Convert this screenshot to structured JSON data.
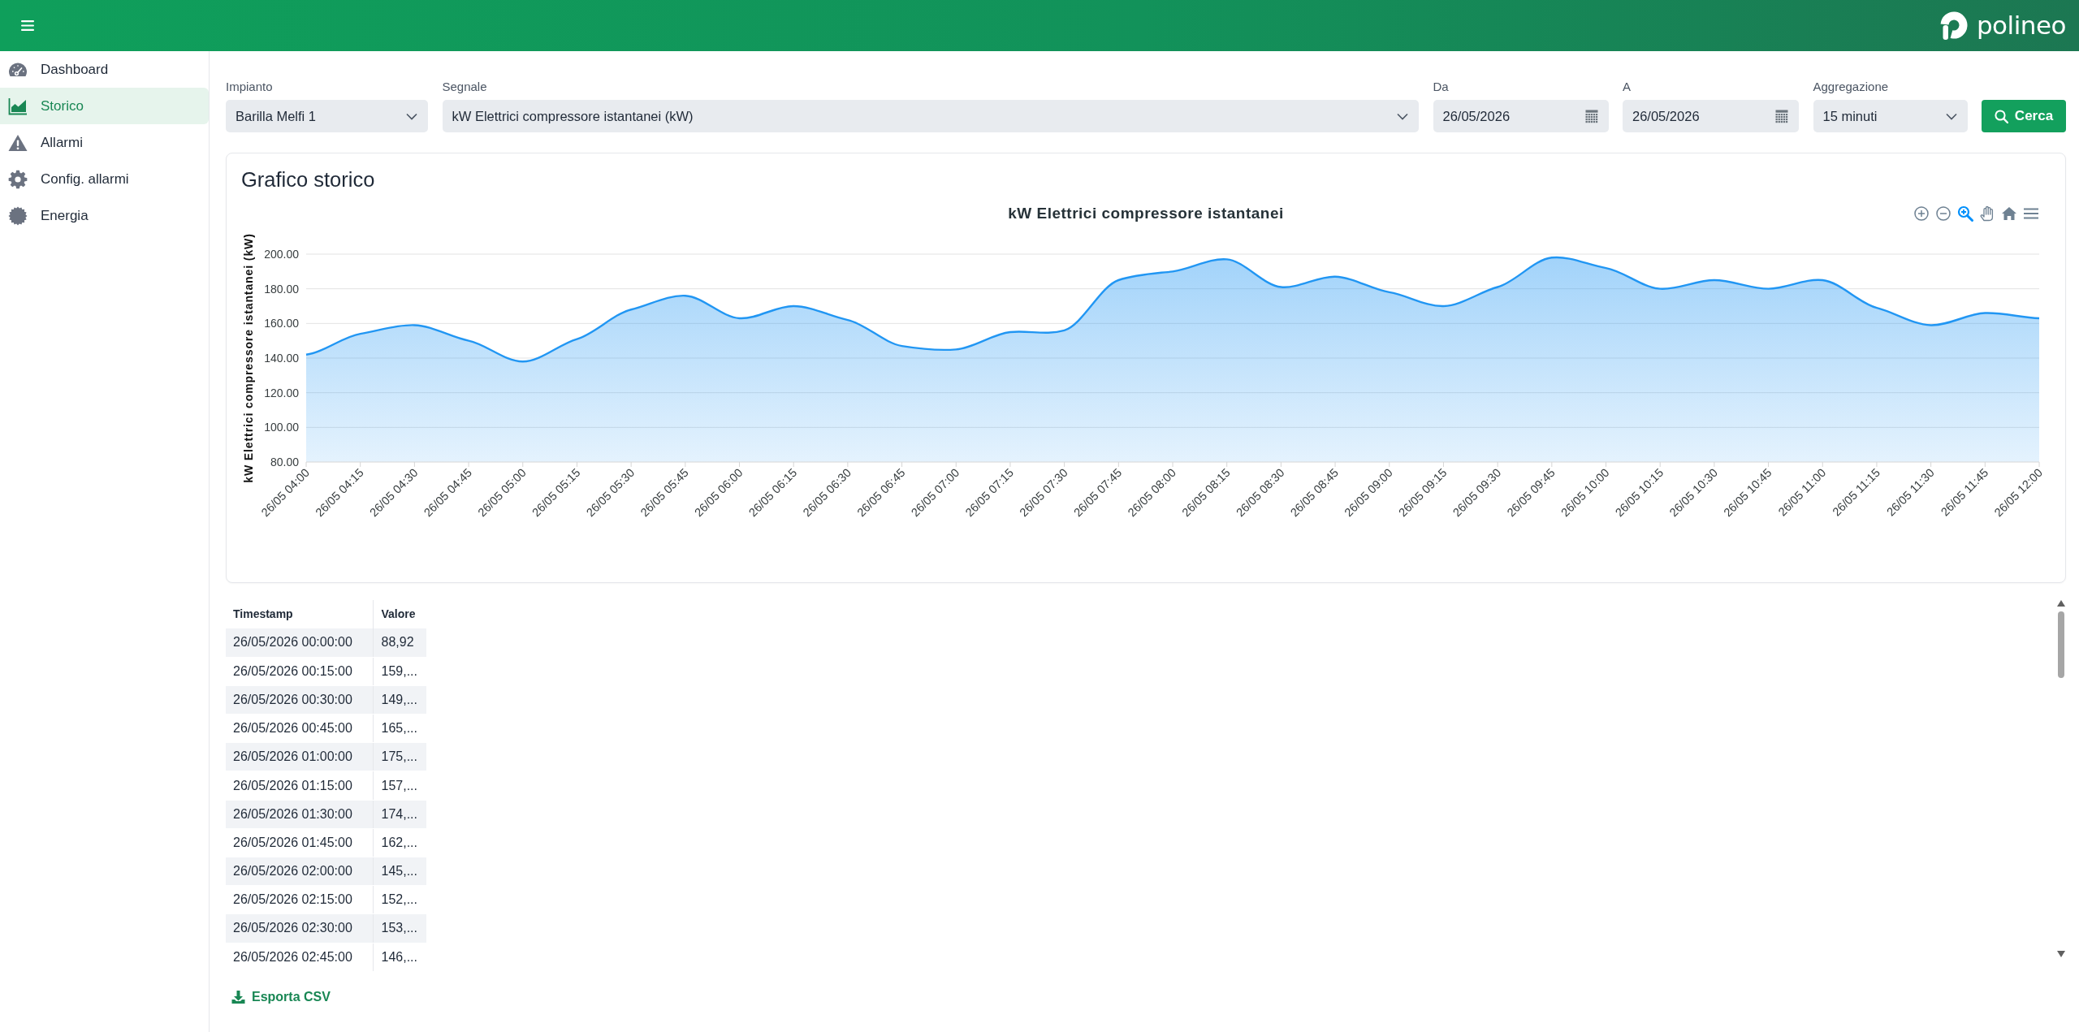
{
  "header": {
    "brand": "polineo"
  },
  "sidebar": {
    "items": [
      {
        "label": "Dashboard",
        "selected": false
      },
      {
        "label": "Storico",
        "selected": true
      },
      {
        "label": "Allarmi",
        "selected": false
      },
      {
        "label": "Config. allarmi",
        "selected": false
      },
      {
        "label": "Energia",
        "selected": false
      }
    ]
  },
  "filters": {
    "fields": [
      {
        "kind": "select",
        "label": "Impianto",
        "value": "Barilla Melfi 1"
      },
      {
        "kind": "select",
        "label": "Segnale",
        "value": "kW Elettrici compressore istantanei (kW)"
      },
      {
        "kind": "date",
        "label": "Da",
        "value": "26/05/2026"
      },
      {
        "kind": "date",
        "label": "A",
        "value": "26/05/2026"
      },
      {
        "kind": "select",
        "label": "Aggregazione",
        "value": "15 minuti"
      }
    ],
    "search_button": "Cerca"
  },
  "chart_card": {
    "title": "Grafico storico",
    "toolbar": [
      {
        "kind": "zoom_in",
        "selected": false
      },
      {
        "kind": "zoom_out",
        "selected": false
      },
      {
        "kind": "zoom",
        "selected": true
      },
      {
        "kind": "pan",
        "selected": false
      },
      {
        "kind": "reset",
        "selected": false
      },
      {
        "kind": "menu",
        "selected": false
      }
    ],
    "chart_data": {
      "type": "area",
      "title": "kW Elettrici compressore istantanei",
      "ylabel": "kW Elettrici compressore istantanei (kW)",
      "categories": [
        "26/05 04:00",
        "26/05 04:15",
        "26/05 04:30",
        "26/05 04:45",
        "26/05 05:00",
        "26/05 05:15",
        "26/05 05:30",
        "26/05 05:45",
        "26/05 06:00",
        "26/05 06:15",
        "26/05 06:30",
        "26/05 06:45",
        "26/05 07:00",
        "26/05 07:15",
        "26/05 07:30",
        "26/05 07:45",
        "26/05 08:00",
        "26/05 08:15",
        "26/05 08:30",
        "26/05 08:45",
        "26/05 09:00",
        "26/05 09:15",
        "26/05 09:30",
        "26/05 09:45",
        "26/05 10:00",
        "26/05 10:15",
        "26/05 10:30",
        "26/05 10:45",
        "26/05 11:00",
        "26/05 11:15",
        "26/05 11:30",
        "26/05 11:45",
        "26/05 12:00"
      ],
      "series": [
        {
          "color": "#2196f3",
          "values": [
            142,
            154,
            159,
            150,
            138,
            151,
            168,
            176,
            163,
            170,
            162,
            147,
            145,
            155,
            156,
            185,
            190,
            197,
            181,
            187,
            178,
            170,
            181,
            198,
            192,
            180,
            185,
            180,
            185,
            169,
            159,
            166,
            163
          ]
        }
      ],
      "ylim": [
        80,
        200
      ],
      "yticks": [
        {
          "value": 80,
          "label": "80.00"
        },
        {
          "value": 100,
          "label": "100.00"
        },
        {
          "value": 120,
          "label": "120.00"
        },
        {
          "value": 140,
          "label": "140.00"
        },
        {
          "value": 160,
          "label": "160.00"
        },
        {
          "value": 180,
          "label": "180.00"
        },
        {
          "value": 200,
          "label": "200.00"
        }
      ],
      "grid": true
    }
  },
  "table": {
    "columns": [
      "Timestamp",
      "Valore"
    ],
    "rows": [
      [
        "26/05/2026 00:00:00",
        "88,92"
      ],
      [
        "26/05/2026 00:15:00",
        "159,..."
      ],
      [
        "26/05/2026 00:30:00",
        "149,..."
      ],
      [
        "26/05/2026 00:45:00",
        "165,..."
      ],
      [
        "26/05/2026 01:00:00",
        "175,..."
      ],
      [
        "26/05/2026 01:15:00",
        "157,..."
      ],
      [
        "26/05/2026 01:30:00",
        "174,..."
      ],
      [
        "26/05/2026 01:45:00",
        "162,..."
      ],
      [
        "26/05/2026 02:00:00",
        "145,..."
      ],
      [
        "26/05/2026 02:15:00",
        "152,..."
      ],
      [
        "26/05/2026 02:30:00",
        "153,..."
      ],
      [
        "26/05/2026 02:45:00",
        "146,..."
      ]
    ]
  },
  "export_link": "Esporta CSV"
}
